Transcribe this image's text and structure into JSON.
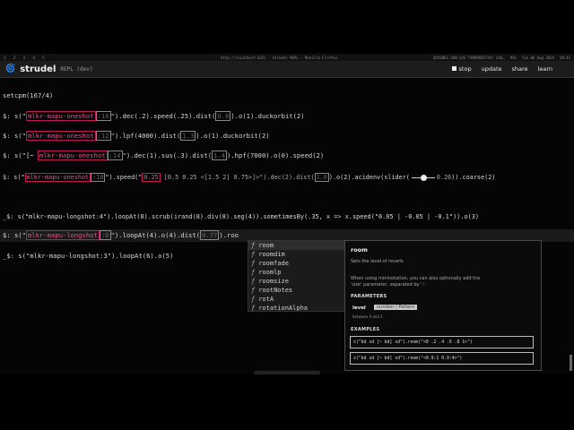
{
  "system_bar": {
    "workspaces": "1 2 3 4 5",
    "window_title": "http://localhost:4321 - Strudel REPL — Mozilla Firefox",
    "tray": [
      "QUIENES SON LOS TXRRXRXSTXS? LOS…",
      "95%",
      "Tue 06 Aug 2024",
      "20:41"
    ]
  },
  "header": {
    "logo_icon": "🌀",
    "brand": "strudel",
    "subtitle": "REPL (dev)",
    "nav": {
      "stop": "stop",
      "update": "update",
      "share": "share",
      "learn": "learn"
    }
  },
  "code": {
    "setcpm": "setcpm(167/4)",
    "l1": {
      "pre": "$: s(\"",
      "sample": "mlkr-mapu-oneshot",
      "idx": ":10",
      "post": "\").dec(.2).speed(.25).dist(",
      "d": "0.8",
      "post2": ").o(1).duckorbit(2)"
    },
    "l2": {
      "pre": "$: s(\"",
      "sample": "mlkr-mapu-oneshot",
      "idx": ":12",
      "post": "\").lpf(4000).dist(",
      "d": "1.3",
      "post2": ").o(1).duckorbit(2)"
    },
    "l3": {
      "pre": "$: s(\"[~ ",
      "sample": "mlkr-mapu-oneshot",
      "idx": ":14",
      "post": "\").dec(1).sus(.3).dist(",
      "d": "1.4",
      "post2": ").hpf(7000).o(0).speed(2)"
    },
    "l4": {
      "pre": "$: s(\"",
      "sample": "mlkr-mapu-oneshot",
      "idx": ":18",
      "post": "\").speed(\"",
      "speedv": "0.25",
      "pattern": " [0.5 0.25 <[1.5 2] 0.75>]>\").dec(2).dist(",
      "d": "1.0",
      "post2": ").o(2).acidenv(slider(",
      "slider_val": "0.26",
      "post3": ")).coarse(2)"
    },
    "l5": "_$: s(\"mlkr-mapu-longshot:4\").loopAt(8).scrub(irand(8).div(8).seg(4)).sometimesBy(.35, x => x.speed(\"0.05 | -0.05 | -0.1\")).o(3)",
    "l6": {
      "pre": "$: s(\"",
      "sample": "mlkr-mapu-longshot",
      "idx": ":0",
      "post": "\").loopAt(4).o(4).dist(",
      "d": "0.77",
      "post2": ").roo"
    },
    "l7": "_$: s(\"mlkr-mapu-longshot:3\").loopAt(6).o(5)"
  },
  "autocomplete": {
    "kind_icon": "ƒ",
    "items": [
      "room",
      "roomdim",
      "roomfade",
      "roomlp",
      "roomsize",
      "rootNotes",
      "rotA",
      "rotationAlpha"
    ]
  },
  "doc": {
    "title": "room",
    "desc": "Sets the level of reverb.",
    "desc2": "When using mininotation, you can also optionally add the",
    "desc3": "'size' parameter, separated by ':'.",
    "params_heading": "PARAMETERS",
    "param_name": "level",
    "param_type": "number | Pattern",
    "param_range": "between 0 and 1",
    "examples_heading": "EXAMPLES",
    "examples": [
      "s(\"bd sd [~ bd] sd\").room(\"<0 .2 .4 .6 .8 1>\")",
      "s(\"bd sd [~ bd] sd\").room(\"<0.9:1 0.9:4>\")"
    ]
  }
}
